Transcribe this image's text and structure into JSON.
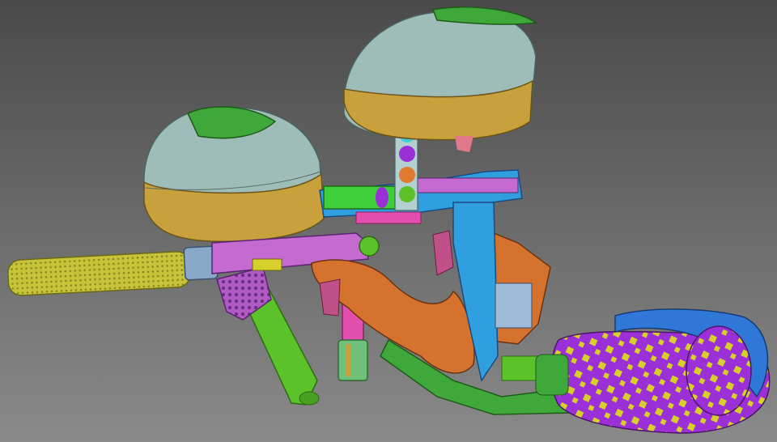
{
  "scene": {
    "background_top": "#4a4a4a",
    "background_bottom": "#8a8a8a"
  },
  "palette": {
    "hopper_shell": "#9fbdb8",
    "hopper_band": "#c9a13c",
    "hopper_lid": "#3fa83a",
    "barrel_tip": "#c8c43a",
    "barrel_body": "#c46ad0",
    "receiver": "#2f9fe0",
    "grip": "#d4722e",
    "trigger": "#c0508a",
    "tank": "#9b2fd8",
    "tank_pattern": "#d8d02a",
    "stock_arm": "#5cc22a",
    "regulator": "#e24fae",
    "tank_cap": "#2f78d8",
    "line_green": "#3a9a3a"
  }
}
